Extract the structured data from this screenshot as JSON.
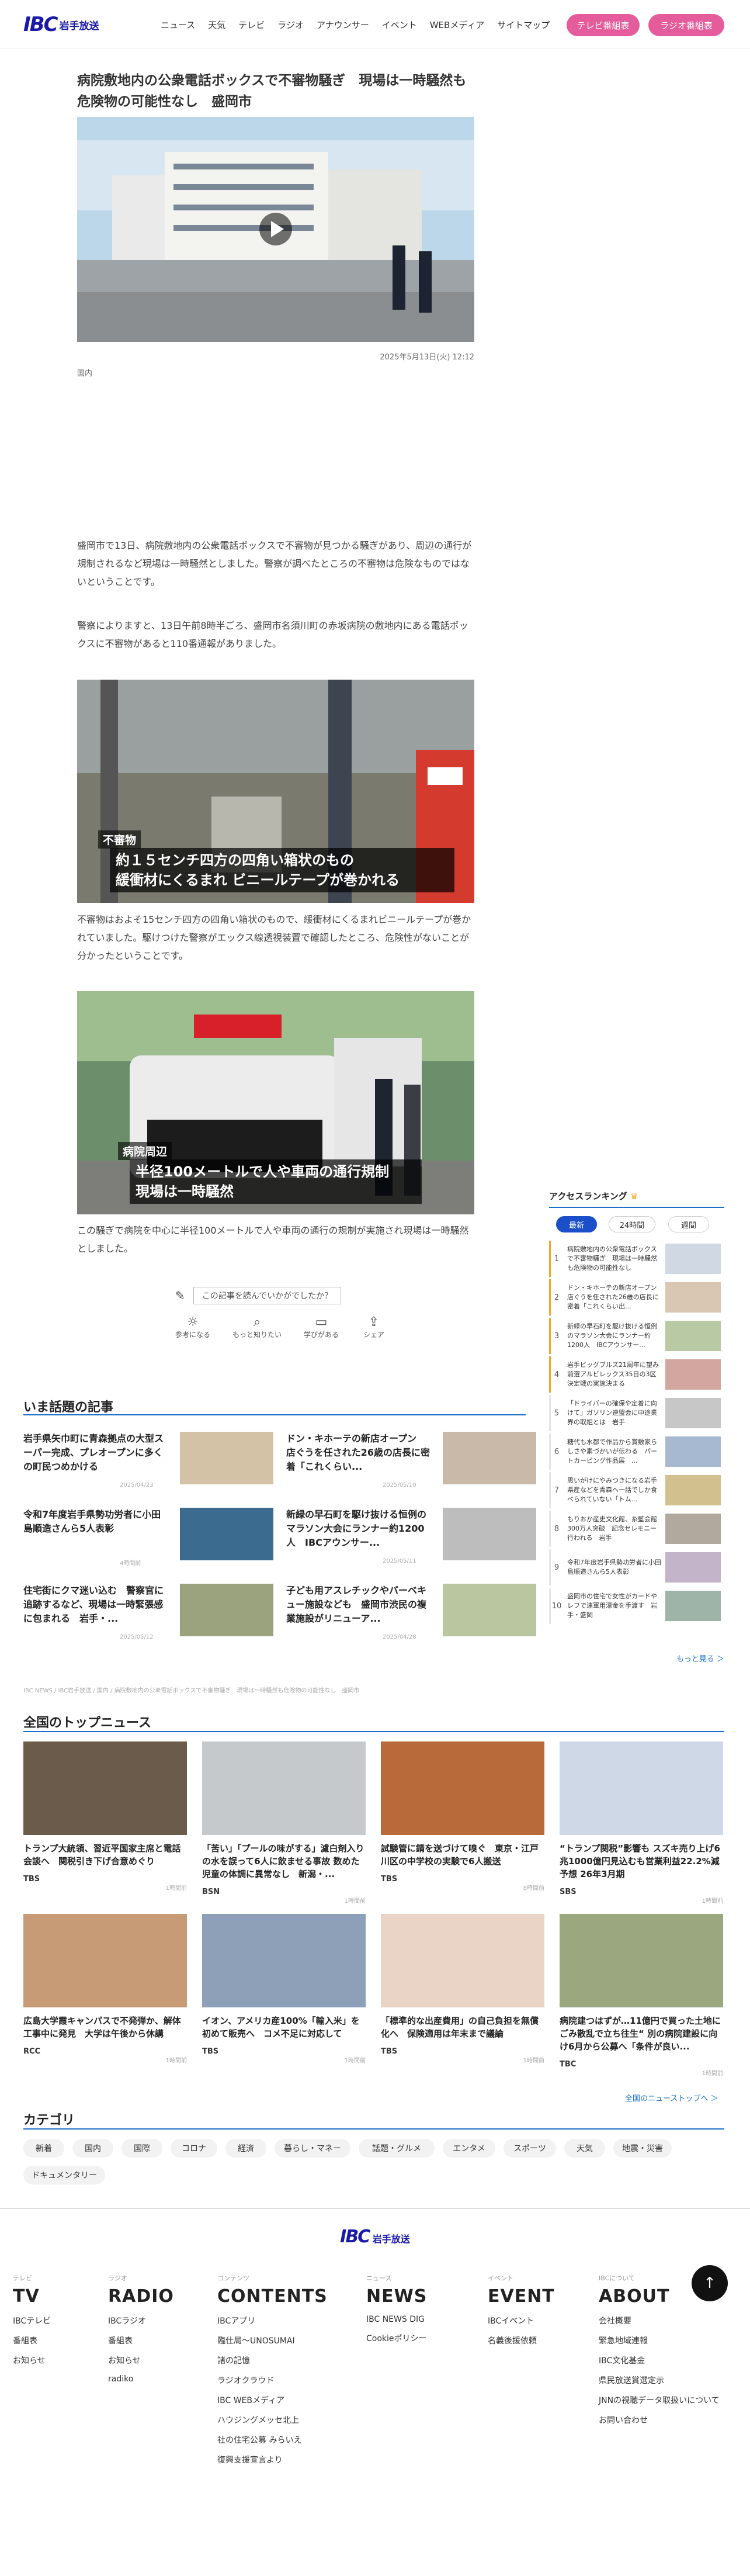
{
  "site": {
    "logo_mark": "IBC",
    "logo_name": "岩手放送"
  },
  "nav": [
    "ニュース",
    "天気",
    "テレビ",
    "ラジオ",
    "アナウンサー",
    "イベント",
    "WEBメディア",
    "サイトマップ"
  ],
  "header_buttons": {
    "tv": "テレビ番組表",
    "radio": "ラジオ番組表"
  },
  "article": {
    "title": "病院敷地内の公衆電話ボックスで不審物騒ぎ　現場は一時騒然も危険物の可能性なし　盛岡市",
    "date": "2025年5月13日(火) 12:12",
    "category": "国内",
    "p1": "盛岡市で13日、病院敷地内の公衆電話ボックスで不審物が見つかる騒ぎがあり、周辺の通行が規制されるなど現場は一時騒然としました。警察が調べたところの不審物は危険なものではないということです。",
    "p2": "警察によりますと、13日午前8時半ごろ、盛岡市名須川町の赤坂病院の敷地内にある電話ボックスに不審物があると110番通報がありました。",
    "img2_tag": "不審物",
    "img2_line1": "約１５センチ四方の四角い箱状のもの",
    "img2_line2": "緩衝材にくるまれ ビニールテープが巻かれる",
    "p3": "不審物はおよそ15センチ四方の四角い箱状のもので、緩衝材にくるまれビニールテープが巻かれていました。駆けつけた警察がエックス線透視装置で確認したところ、危険性がないことが分かったということです。",
    "img3_tag": "病院周辺",
    "img3_line1": "半径100メートルで人や車両の通行規制",
    "img3_line2": "現場は一時騒然",
    "p4": "この騒ぎで病院を中心に半径100メートルで人や車両の通行の規制が実施され現場は一時騒然としました。",
    "feedback_q": "この記事を読んでいかがでしたか？",
    "feedback": [
      "参考になる",
      "もっと知りたい",
      "学びがある",
      "シェア"
    ]
  },
  "ranking": {
    "title": "アクセスランキング",
    "tabs": [
      "最新",
      "24時間",
      "週間"
    ],
    "items": [
      "病院敷地内の公衆電話ボックスで不審物騒ぎ　現場は一時騒然も危険物の可能性なし",
      "ドン・キホーテの新店オープン　店ぐうを任された26歳の店長に密着「これくらい出...",
      "新緑の早石町を駆け抜ける恒例のマラソン大会にランナー約1200人　IBCアウンサー...",
      "岩手ビッグブルズ21周年に望み　前選アルビレックス35日の3区決定戦の実施決まる",
      "「ドライバーの確保や定着に向けて」ガソリン連盟会に中途業界の取組とは　岩手",
      "糖代も水都で作品から賞敷家らしさや素づかいが伝わる　パートカービング作品展　...",
      "思いがけにやみつきになる岩手県産などを青森へ一話でしか食べられていない「トム...",
      "もりおか産史文化館、糸藍会館300万人突破　記念セレモニー行われる　岩手",
      "令和7年度岩手県勢功労者に小田島順造さんら5人表彰",
      "盛岡市の住宅で女性がカードやレフで連軍用漂金を手渡す　岩手・盛岡"
    ],
    "more": "もっと見る ＞"
  },
  "hot": {
    "title": "いま話題の記事",
    "items": [
      {
        "text": "岩手県矢巾町に青森拠点の大型スーパー完成、プレオープンに多くの町民つめかける",
        "date": "2025/04/23"
      },
      {
        "text": "ドン・キホーテの新店オープン　店ぐうを任された26歳の店長に密着「これくらい...",
        "date": "2025/05/10"
      },
      {
        "text": "令和7年度岩手県勢功労者に小田島順造さんら5人表彰",
        "date": "4時間前"
      },
      {
        "text": "新緑の早石町を駆け抜ける恒例のマラソン大会にランナー約1200人　IBCアウンサー...",
        "date": "2025/05/11"
      },
      {
        "text": "住宅街にクマ迷い込む　警察官に追跡するなど、現場は一時緊張感に包まれる　岩手・...",
        "date": "2025/05/12"
      },
      {
        "text": "子ども用アスレチックやバーベキュー施設なども　盛岡市渋民の複業施設がリニューア...",
        "date": "2025/04/28"
      }
    ]
  },
  "breadcrumb": "IBC NEWS / IBC岩手放送 / 国内 / 病院敷地内の公衆電話ボックスで不審物騒ぎ　現場は一時騒然も危険物の可能性なし　盛岡市",
  "top": {
    "title": "全国のトップニュース",
    "items": [
      {
        "text": "トランプ大統領、習近平国家主席と電話会談へ　関税引き下げ合意めぐり",
        "src": "TBS",
        "ago": "1時間前"
      },
      {
        "text": "「苦い」「プールの味がする」濾白剤入りの水を誤って6人に飲ませる事故 数めた児童の体調に異常なし　新潟・...",
        "src": "BSN",
        "ago": "1時間前"
      },
      {
        "text": "試験管に錆を送づけて嗅ぐ　東京・江戸川区の中学校の実験で6人搬送",
        "src": "TBS",
        "ago": "8時間前"
      },
      {
        "text": "“トランプ関税”影響も スズキ売り上げ6兆1000億円見込むも営業利益22.2%減予想 26年3月期",
        "src": "SBS",
        "ago": "1時間前"
      },
      {
        "text": "広島大学霞キャンパスで不発弾か、解体工事中に発見　大学は午後から休講",
        "src": "RCC",
        "ago": "1時間前"
      },
      {
        "text": "イオン、アメリカ産100%「輸入米」を初めて販売へ　コメ不足に対応して",
        "src": "TBS",
        "ago": "1時間前"
      },
      {
        "text": "「標準的な出産費用」の自己負担を無償化へ　保険適用は年末まで議論",
        "src": "TBS",
        "ago": "1時間前"
      },
      {
        "text": "病院建つはずが…11億円で買った土地にごみ散乱で立ち往生“ 別の病院建設に向け6月から公募へ「条件が良い...",
        "src": "TBC",
        "ago": "1時間前"
      }
    ],
    "more": "全国のニューストップへ ＞"
  },
  "categories": {
    "title": "カテゴリ",
    "items": [
      "新着",
      "国内",
      "国際",
      "コロナ",
      "経済",
      "暮らし・マネー",
      "話題・グルメ",
      "エンタメ",
      "スポーツ",
      "天気",
      "地震・災害",
      "ドキュメンタリー"
    ]
  },
  "footer": {
    "cols": [
      {
        "label": "テレビ",
        "big": "TV",
        "links": [
          "IBCテレビ",
          "番組表",
          "お知らせ"
        ]
      },
      {
        "label": "ラジオ",
        "big": "RADIO",
        "links": [
          "IBCラジオ",
          "番組表",
          "お知らせ",
          "radiko"
        ]
      },
      {
        "label": "コンテンツ",
        "big": "CONTENTS",
        "links": [
          "IBCアプリ",
          "臨仕局〜UNOSUMAI",
          "諸の記憶",
          "ラジオクラウド",
          "IBC WEBメディア",
          "ハウジングメッセ北上",
          "社の住宅公募 みらいえ",
          "復興支援宣言より"
        ]
      },
      {
        "label": "ニュース",
        "big": "NEWS",
        "links": [
          "IBC NEWS DIG",
          "Cookieポリシー"
        ]
      },
      {
        "label": "イベント",
        "big": "EVENT",
        "links": [
          "IBCイベント",
          "名義後援依頼"
        ]
      },
      {
        "label": "IBCについて",
        "big": "ABOUT",
        "links": [
          "会社概要",
          "緊急地域連報",
          "IBC文化基金",
          "県民放送賞選定示",
          "JNNの視聴データ取扱いについて",
          "お問い合わせ"
        ]
      }
    ]
  }
}
